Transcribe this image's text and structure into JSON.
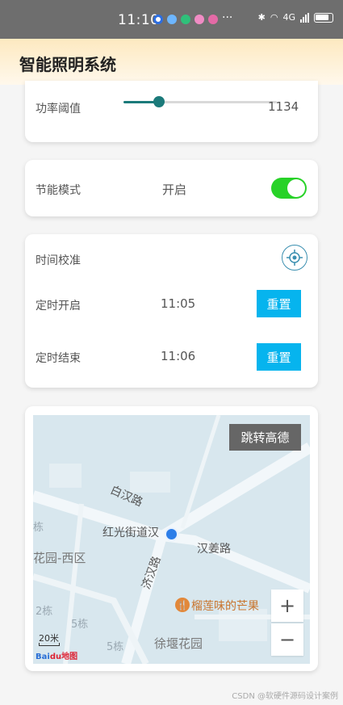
{
  "status_bar": {
    "time": "11:10",
    "more": "···",
    "network": "4G",
    "colors": {
      "background": "#6e6e6e"
    }
  },
  "app": {
    "title": "智能照明系统"
  },
  "power_card": {
    "label": "功率阈值",
    "value": "1134",
    "slider_fraction": 0.23
  },
  "energy_card": {
    "label": "节能模式",
    "state": "开启",
    "toggle_on": true,
    "toggle_color": "#28d228"
  },
  "time_card": {
    "title": "时间校准",
    "rows": [
      {
        "label": "定时开启",
        "time": "11:05",
        "button": "重置"
      },
      {
        "label": "定时结束",
        "time": "11:06",
        "button": "重置"
      }
    ],
    "button_color": "#06b4ee"
  },
  "map_card": {
    "jump_button": "跳转高德",
    "labels": {
      "road1": "白汉路",
      "street": "红光街道汉",
      "road2": "汉姜路",
      "road3": "济汉路",
      "area1": "花园-西区",
      "area2": "徐堰花园",
      "poi": "榴莲味的芒果",
      "b1": "栋",
      "b2": "2栋",
      "b3": "5栋",
      "b4": "5栋"
    },
    "zoom_in": "+",
    "zoom_out": "−",
    "scale": "20米",
    "logo_a": "Bai",
    "logo_b": "du地图"
  },
  "watermark": "CSDN @软硬件源码设计案例"
}
